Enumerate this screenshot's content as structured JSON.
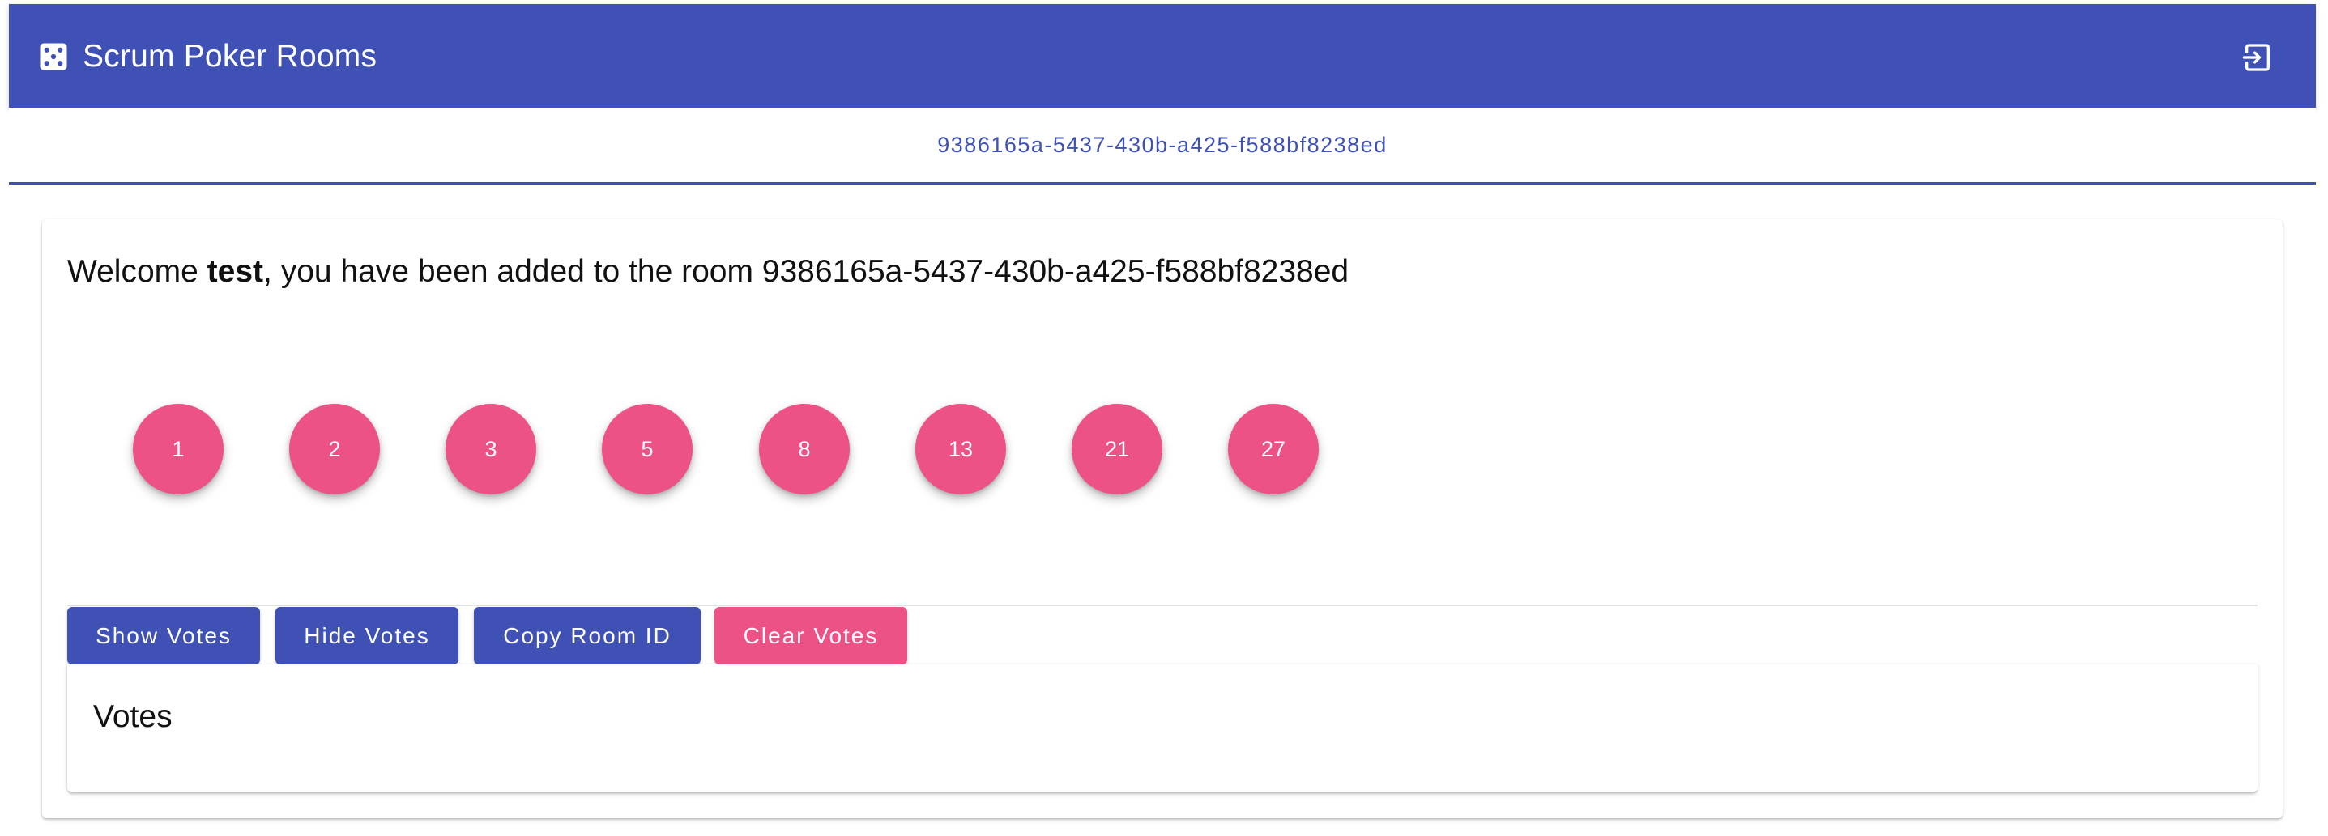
{
  "app": {
    "title": "Scrum Poker Rooms",
    "logo_icon": "dice-icon",
    "logout_icon": "logout-icon",
    "colors": {
      "primary": "#3f51b5",
      "accent": "#ec5285"
    }
  },
  "tabs": [
    {
      "label": "9386165a-5437-430b-a425-f588bf8238ed",
      "selected": true
    }
  ],
  "welcome": {
    "prefix": "Welcome ",
    "user": "test",
    "suffix": ", you have been added to the room 9386165a-5437-430b-a425-f588bf8238ed"
  },
  "vote_cards": [
    "1",
    "2",
    "3",
    "5",
    "8",
    "13",
    "21",
    "27"
  ],
  "actions": {
    "show_votes": "Show Votes",
    "hide_votes": "Hide Votes",
    "copy_room_id": "Copy Room ID",
    "clear_votes": "Clear Votes"
  },
  "votes": {
    "title": "Votes"
  }
}
